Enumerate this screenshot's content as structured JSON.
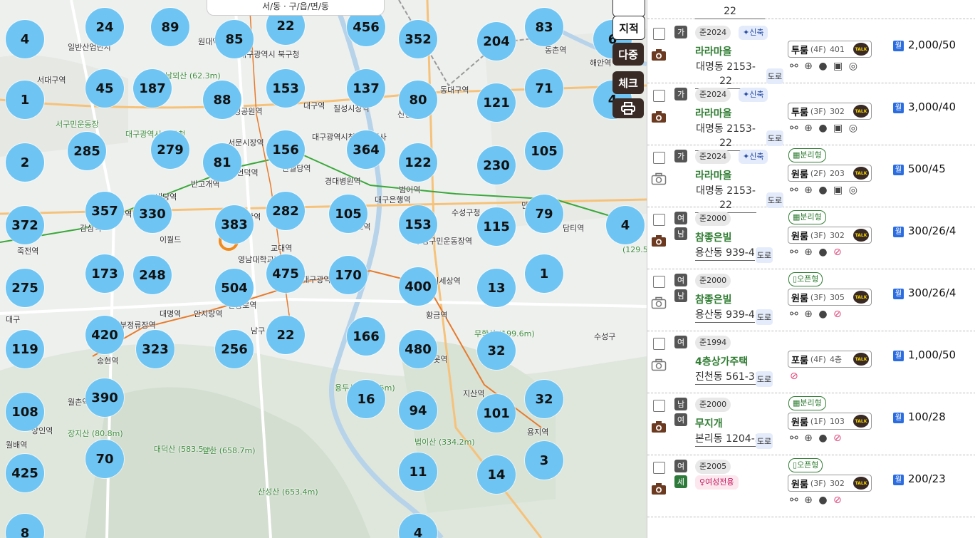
{
  "map": {
    "search_overlay_text": "서/동 · 구/읍/면/동",
    "clusters": [
      {
        "label": "24"
      },
      {
        "label": "89"
      },
      {
        "label": "85"
      },
      {
        "label": "22"
      },
      {
        "label": "456"
      },
      {
        "label": "352"
      },
      {
        "label": "204"
      },
      {
        "label": "83"
      },
      {
        "label": "6"
      },
      {
        "label": "4"
      },
      {
        "label": "45"
      },
      {
        "label": "187"
      },
      {
        "label": "88"
      },
      {
        "label": "153"
      },
      {
        "label": "137"
      },
      {
        "label": "80"
      },
      {
        "label": "121"
      },
      {
        "label": "71"
      },
      {
        "label": "4"
      },
      {
        "label": "1"
      },
      {
        "label": "285"
      },
      {
        "label": "279"
      },
      {
        "label": "81"
      },
      {
        "label": "156"
      },
      {
        "label": "364"
      },
      {
        "label": "122"
      },
      {
        "label": "230"
      },
      {
        "label": "105"
      },
      {
        "label": "2"
      },
      {
        "label": "357"
      },
      {
        "label": "330"
      },
      {
        "label": "383"
      },
      {
        "label": "282"
      },
      {
        "label": "105"
      },
      {
        "label": "153"
      },
      {
        "label": "115"
      },
      {
        "label": "79"
      },
      {
        "label": "4"
      },
      {
        "label": "372"
      },
      {
        "label": "173"
      },
      {
        "label": "248"
      },
      {
        "label": "504"
      },
      {
        "label": "475"
      },
      {
        "label": "170"
      },
      {
        "label": "400"
      },
      {
        "label": "13"
      },
      {
        "label": "1"
      },
      {
        "label": "275"
      },
      {
        "label": "420"
      },
      {
        "label": "323"
      },
      {
        "label": "256"
      },
      {
        "label": "22"
      },
      {
        "label": "166"
      },
      {
        "label": "480"
      },
      {
        "label": "32"
      },
      {
        "label": "119"
      },
      {
        "label": "390"
      },
      {
        "label": "16"
      },
      {
        "label": "94"
      },
      {
        "label": "101"
      },
      {
        "label": "32"
      },
      {
        "label": "108"
      },
      {
        "label": "70"
      },
      {
        "label": "11"
      },
      {
        "label": "14"
      },
      {
        "label": "3"
      },
      {
        "label": "425"
      },
      {
        "label": "8"
      },
      {
        "label": "4"
      }
    ],
    "place_labels": [
      {
        "text": "서대구역"
      },
      {
        "text": "서구민운동장"
      },
      {
        "text": "대구광역시 서구청"
      },
      {
        "text": "날뫼산 (62.3m)"
      },
      {
        "text": "대구광역시 북구청"
      },
      {
        "text": "달성공원역"
      },
      {
        "text": "서문시장역"
      },
      {
        "text": "청라언덕역"
      },
      {
        "text": "반월당역"
      },
      {
        "text": "경대병원역"
      },
      {
        "text": "대구은행역"
      },
      {
        "text": "대구역"
      },
      {
        "text": "칠성시장역"
      },
      {
        "text": "신천역"
      },
      {
        "text": "동대구역"
      },
      {
        "text": "동촌역"
      },
      {
        "text": "해안역"
      },
      {
        "text": "대구광역시청 동인청사"
      },
      {
        "text": "반고개역"
      },
      {
        "text": "내당역"
      },
      {
        "text": "두류역"
      },
      {
        "text": "감삼역"
      },
      {
        "text": "죽전역"
      },
      {
        "text": "이월드"
      },
      {
        "text": "남산역"
      },
      {
        "text": "교대역"
      },
      {
        "text": "영남대학교병원"
      },
      {
        "text": "현충로역"
      },
      {
        "text": "대구광역시 남구청"
      },
      {
        "text": "대봉교역"
      },
      {
        "text": "수성구청"
      },
      {
        "text": "범어역"
      },
      {
        "text": "만촌역"
      },
      {
        "text": "담티역"
      },
      {
        "text": "수성구민운동장역"
      },
      {
        "text": "어린이세상역"
      },
      {
        "text": "황금역"
      },
      {
        "text": "무학산 (199.6m)"
      },
      {
        "text": "수성구"
      },
      {
        "text": "수성못역"
      },
      {
        "text": "지산역"
      },
      {
        "text": "용지역"
      },
      {
        "text": "대명역"
      },
      {
        "text": "안지랑역"
      },
      {
        "text": "서부정류장역"
      },
      {
        "text": "송현역"
      },
      {
        "text": "월촌역"
      },
      {
        "text": "장지산 (80.8m)"
      },
      {
        "text": "대덕산 (583.5m)"
      },
      {
        "text": "앞산 (658.7m)"
      },
      {
        "text": "용두산 (186.5m)"
      },
      {
        "text": "법이산 (334.2m)"
      },
      {
        "text": "산성산 (653.4m)"
      },
      {
        "text": "상인역"
      },
      {
        "text": "월배역"
      },
      {
        "text": "남구"
      },
      {
        "text": "대구"
      },
      {
        "text": "일반산업단지"
      },
      {
        "text": "(129.5m)"
      },
      {
        "text": "원대역"
      }
    ],
    "side_buttons": [
      {
        "label": "지적"
      },
      {
        "label": "다중"
      },
      {
        "label": "체크"
      },
      {
        "label": "print-icon"
      }
    ]
  },
  "listings": [
    {
      "gender": "가",
      "year": "준2024",
      "new_label": "신축",
      "name": "라라마을",
      "address": "대명동 2153-22",
      "road": "도로",
      "room_type": "투룸",
      "floor": "(4F)",
      "unit": "401",
      "type_tag": "",
      "price": "2,000/50",
      "has_photo": true
    },
    {
      "gender": "가",
      "year": "준2024",
      "new_label": "신축",
      "name": "라라마을",
      "address": "대명동 2153-22",
      "road": "도로",
      "room_type": "투룸",
      "floor": "(3F)",
      "unit": "302",
      "type_tag": "",
      "price": "3,000/40",
      "has_photo": true
    },
    {
      "gender": "가",
      "year": "준2024",
      "new_label": "신축",
      "name": "라라마을",
      "address": "대명동 2153-22",
      "road": "도로",
      "room_type": "원룸",
      "floor": "(2F)",
      "unit": "203",
      "type_tag": "분리형",
      "price": "500/45",
      "has_photo": false
    },
    {
      "gender": "여",
      "gender2": "남",
      "year": "준2000",
      "name": "참좋은빌",
      "address": "용산동 939-4",
      "road": "도로",
      "room_type": "원룸",
      "floor": "(3F)",
      "unit": "302",
      "type_tag": "분리형",
      "price": "300/26/4",
      "has_photo": true
    },
    {
      "gender": "여",
      "gender2": "남",
      "year": "준2000",
      "name": "참좋은빌",
      "address": "용산동 939-4",
      "road": "도로",
      "room_type": "원룸",
      "floor": "(3F)",
      "unit": "305",
      "type_tag": "오픈형",
      "price": "300/26/4",
      "has_photo": false
    },
    {
      "gender": "여",
      "year": "준1994",
      "name": "4층상가주택",
      "address": "진천동 561-31",
      "road": "도로",
      "room_type": "포룸",
      "floor": "(4F)",
      "unit": "4층",
      "type_tag": "",
      "price": "1,000/50",
      "has_photo": false
    },
    {
      "gender": "남",
      "gender2": "여",
      "year": "준2000",
      "name": "무지개",
      "address": "본리동 1204-3",
      "road": "도로",
      "room_type": "원룸",
      "floor": "(1F)",
      "unit": "103",
      "type_tag": "분리형",
      "price": "100/28",
      "has_photo": true
    },
    {
      "gender": "여",
      "gender2": "세",
      "year": "준2005",
      "women_only": "여성전용",
      "name": "",
      "address": "",
      "road": "",
      "room_type": "원룸",
      "floor": "(3F)",
      "unit": "302",
      "type_tag": "오픈형",
      "price": "200/23",
      "has_photo": true
    }
  ],
  "top_row": {
    "address_tail": "22"
  },
  "talk_label": "TALK",
  "monthly_label": "월",
  "colors": {
    "cluster": "#6ec5f3",
    "accent_green": "#2f7d32",
    "dark_brown": "#3a2a25",
    "price_badge": "#2b6de0"
  }
}
